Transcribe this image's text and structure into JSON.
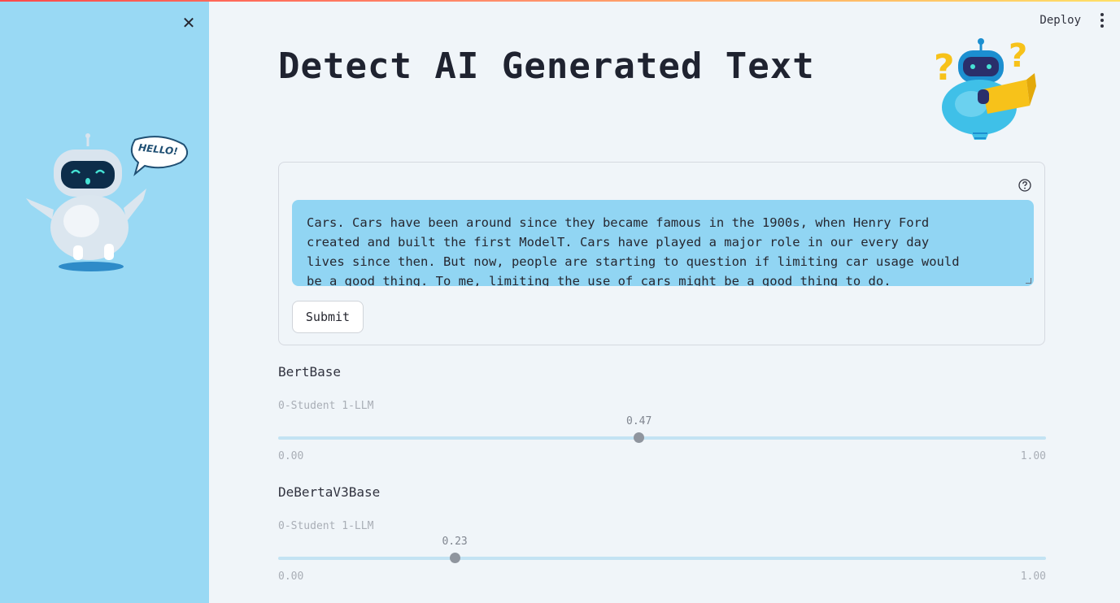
{
  "sidebar": {
    "close_icon": "close-icon",
    "image": "robot-hello-illustration",
    "speech_bubble_text": "HELLO!"
  },
  "header": {
    "deploy_label": "Deploy",
    "menu_icon": "kebab-menu-icon"
  },
  "main": {
    "title": "Detect AI Generated Text",
    "header_image": "robot-reading-illustration",
    "form": {
      "help_icon": "question-circle-icon",
      "text_value": "Cars. Cars have been around since they became famous in the 1900s, when Henry Ford\ncreated and built the first ModelT. Cars have played a major role in our every day\nlives since then. But now, people are starting to question if limiting car usage would\nbe a good thing. To me, limiting the use of cars might be a good thing to do.",
      "submit_label": "Submit"
    },
    "sliders": [
      {
        "label": "BertBase",
        "caption": "0-Student 1-LLM",
        "value": 0.47,
        "value_text": "0.47",
        "min_text": "0.00",
        "max_text": "1.00"
      },
      {
        "label": "DeBertaV3Base",
        "caption": "0-Student 1-LLM",
        "value": 0.23,
        "value_text": "0.23",
        "min_text": "0.00",
        "max_text": "1.00"
      }
    ]
  },
  "colors": {
    "sidebar_bg": "#99d9f4",
    "page_bg": "#f0f5f9",
    "textarea_bg": "#91d5f3",
    "slider_track": "#c3e3f3",
    "slider_thumb": "#8f959e",
    "title_text": "#1f2330"
  }
}
